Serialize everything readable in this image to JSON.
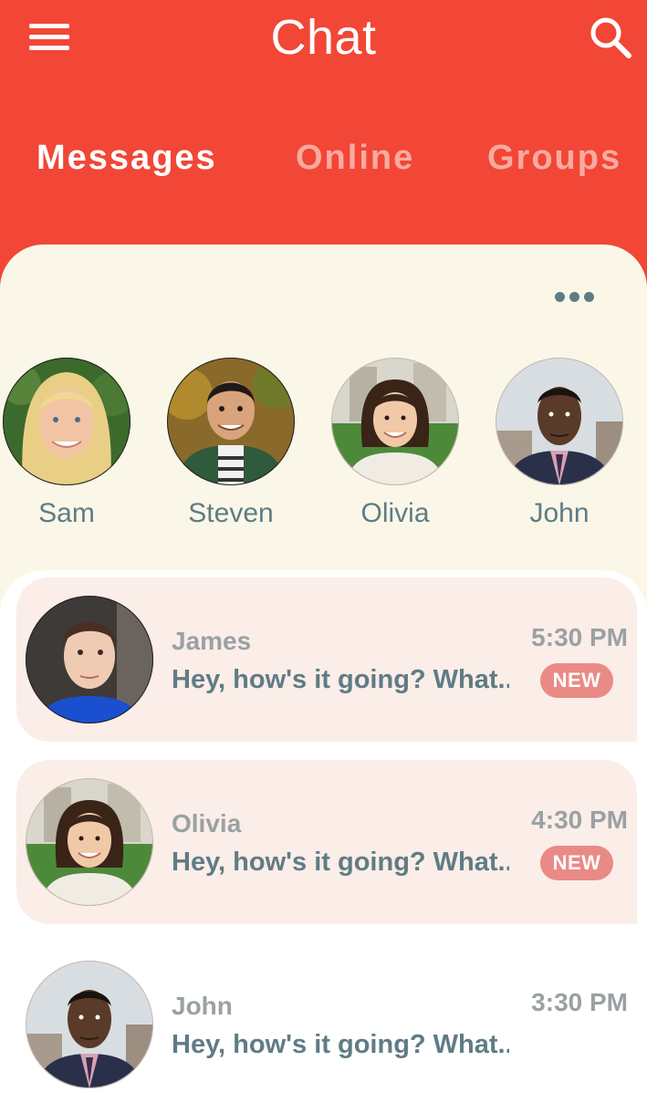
{
  "app": {
    "title": "Chat"
  },
  "icons": {
    "menu": "hamburger-menu-icon",
    "search": "search-icon",
    "more": "more-horizontal-icon"
  },
  "colors": {
    "primary": "#f24636",
    "favorites_bg": "#faf7e8",
    "unread_bg": "#fbede8",
    "badge": "#ea8a86",
    "text": "#5f7c85",
    "muted": "#9aa1a3"
  },
  "tabs": [
    {
      "label": "Messages",
      "active": true
    },
    {
      "label": "Online",
      "active": false
    },
    {
      "label": "Groups",
      "active": false
    }
  ],
  "favorites": [
    {
      "name": "Sam"
    },
    {
      "name": "Steven"
    },
    {
      "name": "Olivia"
    },
    {
      "name": "John"
    }
  ],
  "chats": [
    {
      "sender": "James",
      "preview": "Hey, how's it going? What...",
      "time": "5:30 PM",
      "badge": "NEW",
      "unread": true
    },
    {
      "sender": "Olivia",
      "preview": "Hey, how's it going? What...",
      "time": "4:30 PM",
      "badge": "NEW",
      "unread": true
    },
    {
      "sender": "John",
      "preview": "Hey, how's it going? What...",
      "time": "3:30 PM",
      "unread": false
    }
  ]
}
